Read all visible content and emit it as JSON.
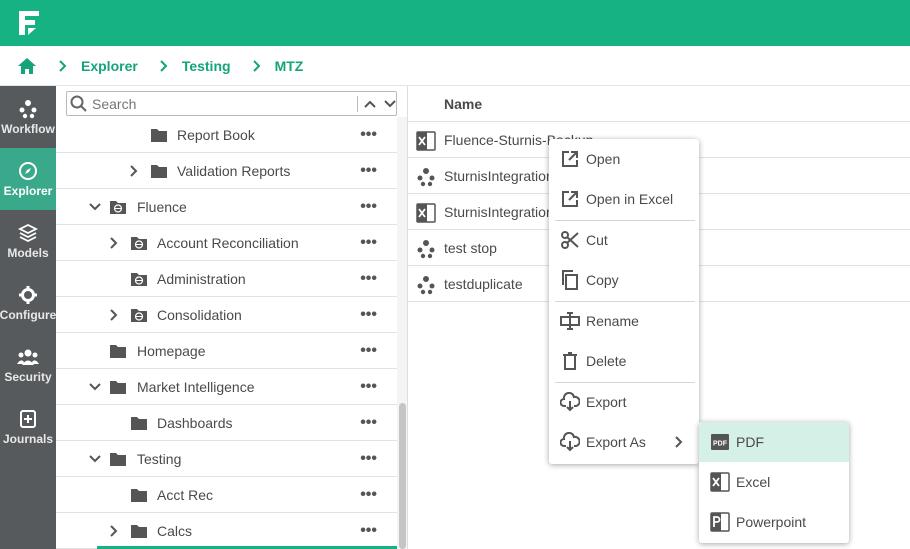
{
  "colors": {
    "brand": "#17b284",
    "nav_bg": "#565a5c",
    "nav_active": "#3aa88a",
    "highlight": "#d5f0e6"
  },
  "breadcrumb": {
    "items": [
      "Explorer",
      "Testing",
      "MTZ"
    ]
  },
  "leftnav": {
    "items": [
      {
        "label": "Workflow",
        "icon": "workflow-icon",
        "active": false
      },
      {
        "label": "Explorer",
        "icon": "compass-icon",
        "active": true
      },
      {
        "label": "Models",
        "icon": "layers-icon",
        "active": false
      },
      {
        "label": "Configure",
        "icon": "gear-icon",
        "active": false
      },
      {
        "label": "Security",
        "icon": "users-icon",
        "active": false
      },
      {
        "label": "Journals",
        "icon": "journal-icon",
        "active": false
      }
    ]
  },
  "tree": {
    "search_placeholder": "Search",
    "rows": [
      {
        "label": "Report Book",
        "icon": "folder-icon",
        "expander": "none"
      },
      {
        "label": "Validation Reports",
        "icon": "folder-icon",
        "expander": "collapsed"
      },
      {
        "label": "Fluence",
        "icon": "globe-folder-icon",
        "expander": "expanded"
      },
      {
        "label": "Account Reconciliation",
        "icon": "globe-folder-icon",
        "expander": "collapsed"
      },
      {
        "label": "Administration",
        "icon": "globe-folder-icon",
        "expander": "none"
      },
      {
        "label": "Consolidation",
        "icon": "globe-folder-icon",
        "expander": "collapsed"
      },
      {
        "label": "Homepage",
        "icon": "folder-icon",
        "expander": "none"
      },
      {
        "label": "Market Intelligence",
        "icon": "folder-icon",
        "expander": "expanded"
      },
      {
        "label": "Dashboards",
        "icon": "folder-icon",
        "expander": "none"
      },
      {
        "label": "Testing",
        "icon": "folder-icon",
        "expander": "expanded"
      },
      {
        "label": "Acct Rec",
        "icon": "folder-icon",
        "expander": "none"
      },
      {
        "label": "Calcs",
        "icon": "folder-icon",
        "expander": "collapsed"
      }
    ],
    "more_label": "•••"
  },
  "list": {
    "header": "Name",
    "rows": [
      {
        "name": "Fluence-Sturnis-Backup",
        "icon": "excel-icon"
      },
      {
        "name": "SturnisIntegration",
        "icon": "workflow-icon"
      },
      {
        "name": "SturnisIntegration",
        "icon": "excel-icon"
      },
      {
        "name": "test stop",
        "icon": "workflow-icon"
      },
      {
        "name": "testduplicate",
        "icon": "workflow-icon"
      }
    ]
  },
  "context_menu": {
    "items": [
      {
        "label": "Open",
        "icon": "open-external-icon"
      },
      {
        "label": "Open in Excel",
        "icon": "open-external-icon"
      },
      {
        "label": "Cut",
        "icon": "scissors-icon"
      },
      {
        "label": "Copy",
        "icon": "copy-icon"
      },
      {
        "label": "Rename",
        "icon": "rename-icon"
      },
      {
        "label": "Delete",
        "icon": "trash-icon"
      },
      {
        "label": "Export",
        "icon": "cloud-download-icon"
      },
      {
        "label": "Export As",
        "icon": "cloud-export-icon"
      }
    ]
  },
  "submenu": {
    "items": [
      {
        "label": "PDF",
        "icon": "pdf-icon"
      },
      {
        "label": "Excel",
        "icon": "excel-icon"
      },
      {
        "label": "Powerpoint",
        "icon": "powerpoint-icon"
      }
    ]
  }
}
